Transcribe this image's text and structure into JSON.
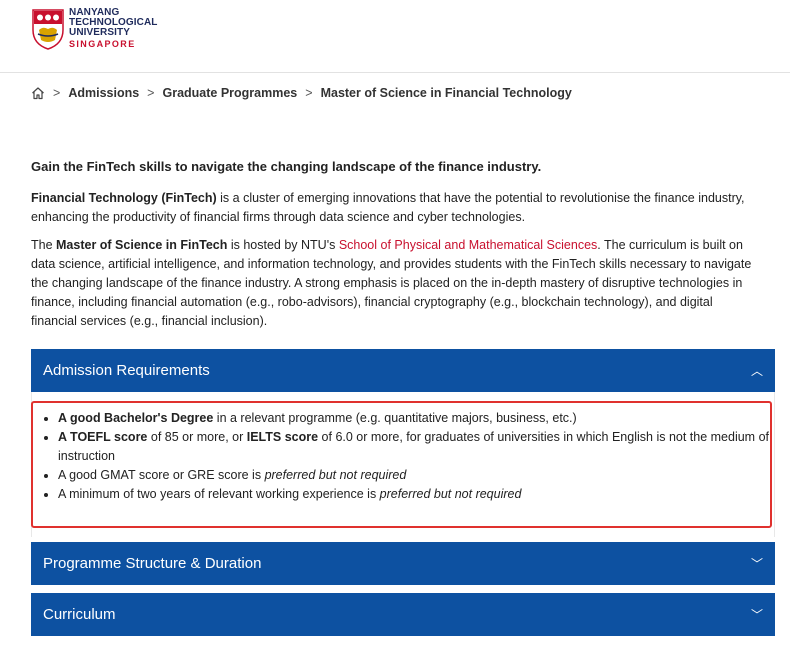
{
  "header": {
    "logo_line1": "NANYANG",
    "logo_line2": "TECHNOLOGICAL",
    "logo_line3": "UNIVERSITY",
    "logo_line4": "SINGAPORE"
  },
  "breadcrumb": {
    "items": [
      "Admissions",
      "Graduate Programmes",
      "Master of Science in Financial Technology"
    ],
    "separator": ">"
  },
  "intro": {
    "lead": "Gain the FinTech skills to navigate the changing landscape of the finance industry.",
    "p1_bold": "Financial Technology (FinTech)",
    "p1_rest": " is a cluster of emerging innovations that have the potential to revolutionise the finance industry, enhancing the productivity of financial firms through data science and cyber technologies.",
    "p2_a": "The ",
    "p2_bold": "Master of Science in FinTech",
    "p2_b": " is hosted by NTU's ",
    "p2_link": "School of Physical and Mathematical Sciences",
    "p2_c": ". The curriculum is built on data science, artificial intelligence, and information technology, and provides students with the FinTech skills necessary to navigate the changing landscape of the finance industry. A strong emphasis is placed on the in-depth mastery of disruptive technologies in finance, including financial automation (e.g., robo-advisors), financial cryptography (e.g., blockchain technology), and digital financial services (e.g., financial inclusion)."
  },
  "accordion": {
    "sections": [
      {
        "title": "Admission Requirements",
        "expanded": true
      },
      {
        "title": "Programme Structure & Duration",
        "expanded": false
      },
      {
        "title": "Curriculum",
        "expanded": false
      }
    ],
    "chevron_up": "︿",
    "chevron_down": "﹀"
  },
  "requirements": {
    "item1_bold": "A good Bachelor's Degree",
    "item1_rest": " in a relevant programme (e.g. quantitative majors, business, etc.)",
    "item2_bold1": "A TOEFL score",
    "item2_mid": " of 85 or more, or ",
    "item2_bold2": "IELTS score",
    "item2_rest": " of 6.0 or more, for graduates of universities in which English is not the medium of instruction",
    "item3_text": "A good GMAT score or GRE score is ",
    "item3_italic": "preferred but not required",
    "item4_text": "A minimum of two years of relevant working experience is ",
    "item4_italic": "preferred but not required"
  },
  "colors": {
    "accent": "#0d51a1",
    "brand_red": "#c8102e",
    "highlight_border": "#e0312e"
  }
}
